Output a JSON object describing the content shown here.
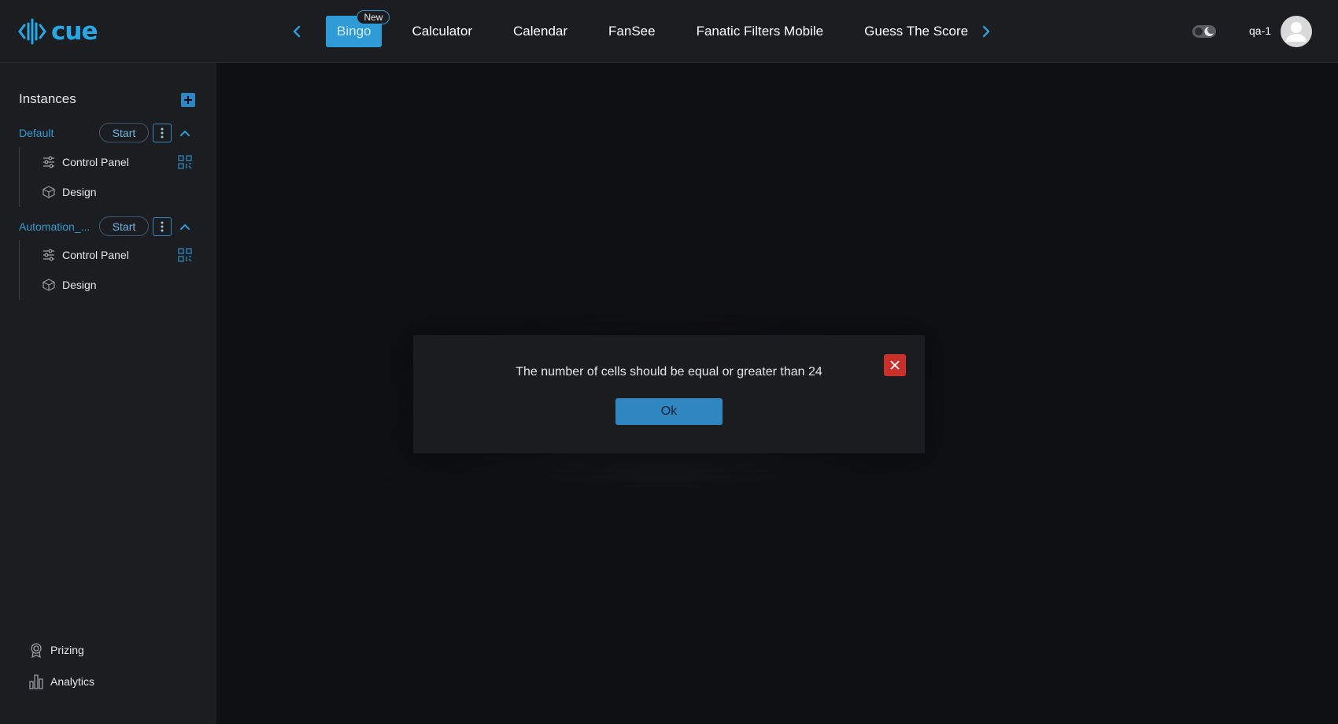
{
  "app": {
    "logo_text": "cue",
    "username": "qa-1"
  },
  "colors": {
    "accent": "#2f9bd6",
    "topbar_bg": "#1c1d20",
    "content_bg": "#0f1012",
    "danger": "#c9302c"
  },
  "tabs": [
    {
      "label": "Bingo",
      "badge": "New",
      "active": true
    },
    {
      "label": "Calculator"
    },
    {
      "label": "Calendar"
    },
    {
      "label": "FanSee"
    },
    {
      "label": "Fanatic Filters Mobile"
    },
    {
      "label": "Guess The Score"
    }
  ],
  "sidebar": {
    "header": "Instances",
    "instances": [
      {
        "name": "Default",
        "start_label": "Start",
        "children": [
          {
            "label": "Control Panel"
          },
          {
            "label": "Design"
          }
        ]
      },
      {
        "name": "Automation_...",
        "start_label": "Start",
        "children": [
          {
            "label": "Control Panel"
          },
          {
            "label": "Design"
          }
        ]
      }
    ],
    "bottom_links": [
      {
        "label": "Prizing"
      },
      {
        "label": "Analytics"
      }
    ]
  },
  "modal": {
    "message": "The number of cells should be equal or greater than 24",
    "ok_label": "Ok"
  }
}
